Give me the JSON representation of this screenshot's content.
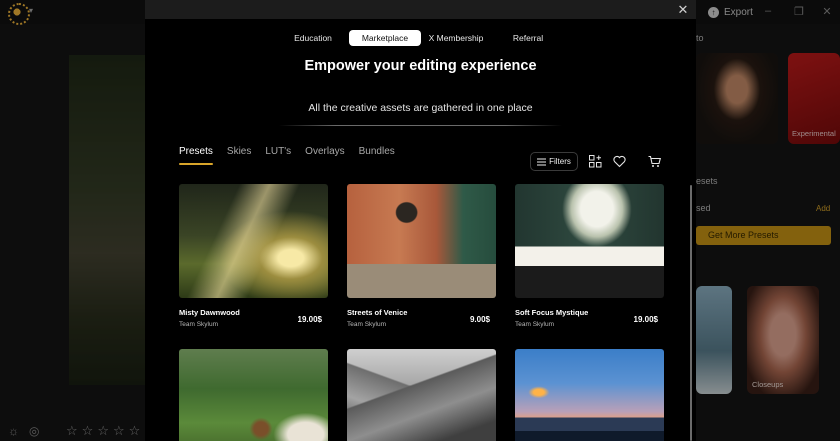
{
  "background": {
    "export_label": "Export",
    "panel_labels": {
      "section_top": "to",
      "experimental": "Experimental",
      "presets": "esets",
      "used": "sed",
      "add": "Add",
      "get_more": "Get More Presets",
      "closeups": "Closeups"
    }
  },
  "modal": {
    "top_tabs": [
      {
        "label": "Education",
        "active": false
      },
      {
        "label": "Marketplace",
        "active": true
      },
      {
        "label": "X Membership",
        "active": false
      },
      {
        "label": "Referral",
        "active": false
      }
    ],
    "title": "Empower your editing experience",
    "subtitle": "All the creative assets are gathered in one place",
    "category_tabs": [
      {
        "label": "Presets",
        "active": true
      },
      {
        "label": "Skies",
        "active": false
      },
      {
        "label": "LUT's",
        "active": false
      },
      {
        "label": "Overlays",
        "active": false
      },
      {
        "label": "Bundles",
        "active": false
      }
    ],
    "filters_label": "Filters",
    "products": [
      {
        "name": "Misty Dawnwood",
        "author": "Team Skylum",
        "price": "19.00$"
      },
      {
        "name": "Streets of Venice",
        "author": "Team Skylum",
        "price": "9.00$"
      },
      {
        "name": "Soft Focus Mystique",
        "author": "Team Skylum",
        "price": "19.00$"
      },
      {
        "name": "",
        "author": "",
        "price": ""
      },
      {
        "name": "",
        "author": "",
        "price": ""
      },
      {
        "name": "",
        "author": "",
        "price": ""
      }
    ]
  },
  "colors": {
    "accent": "#d9a52a",
    "modal_bg": "#000000",
    "active_tab_bg": "#ffffff"
  },
  "icons": [
    "close-icon",
    "filters-icon",
    "apps-icon",
    "heart-icon",
    "cart-icon"
  ]
}
